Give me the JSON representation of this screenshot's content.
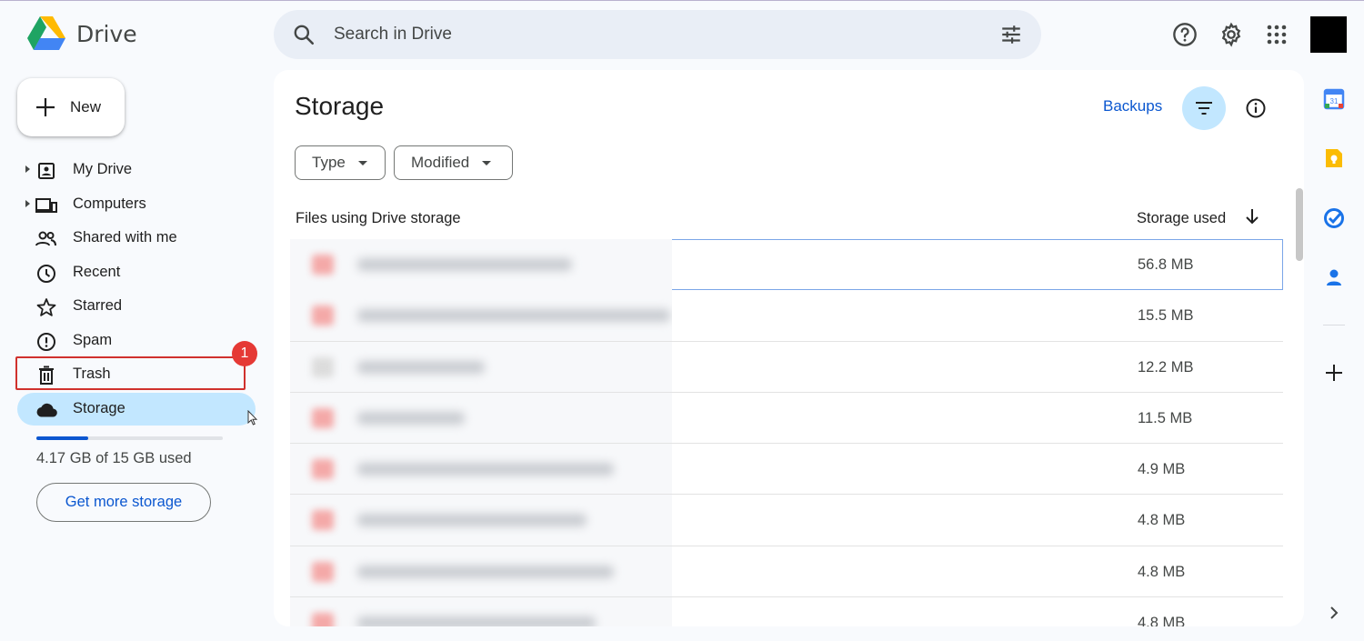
{
  "app": {
    "name": "Drive"
  },
  "search": {
    "placeholder": "Search in Drive"
  },
  "new_button": {
    "label": "New"
  },
  "nav": {
    "items": [
      {
        "label": "My Drive",
        "icon": "my-drive-icon",
        "expandable": true
      },
      {
        "label": "Computers",
        "icon": "computers-icon",
        "expandable": true
      },
      {
        "label": "Shared with me",
        "icon": "people-icon",
        "expandable": false
      },
      {
        "label": "Recent",
        "icon": "clock-icon",
        "expandable": false
      },
      {
        "label": "Starred",
        "icon": "star-icon",
        "expandable": false
      },
      {
        "label": "Spam",
        "icon": "spam-icon",
        "expandable": false
      },
      {
        "label": "Trash",
        "icon": "trash-icon",
        "expandable": false
      },
      {
        "label": "Storage",
        "icon": "cloud-icon",
        "expandable": false,
        "active": true
      }
    ]
  },
  "annotation": {
    "badge": "1"
  },
  "storage": {
    "used_text": "4.17 GB of 15 GB used",
    "used_fraction": 0.278,
    "button_label": "Get more storage"
  },
  "main": {
    "title": "Storage",
    "backups_label": "Backups",
    "filters": [
      {
        "label": "Type"
      },
      {
        "label": "Modified"
      }
    ],
    "columns": {
      "name": "Files using Drive storage",
      "size": "Storage used"
    },
    "rows": [
      {
        "size": "56.8 MB",
        "icon_color": "red"
      },
      {
        "size": "15.5 MB",
        "icon_color": "red"
      },
      {
        "size": "12.2 MB",
        "icon_color": "grey"
      },
      {
        "size": "11.5 MB",
        "icon_color": "red"
      },
      {
        "size": "4.9 MB",
        "icon_color": "red"
      },
      {
        "size": "4.8 MB",
        "icon_color": "red"
      },
      {
        "size": "4.8 MB",
        "icon_color": "red"
      },
      {
        "size": "4.8 MB",
        "icon_color": "red"
      }
    ]
  },
  "side_panel": {
    "calendar_day": "31"
  },
  "colors": {
    "accent": "#0b57d0",
    "active_bg": "#c2e7ff",
    "highlight": "#d0312d"
  }
}
